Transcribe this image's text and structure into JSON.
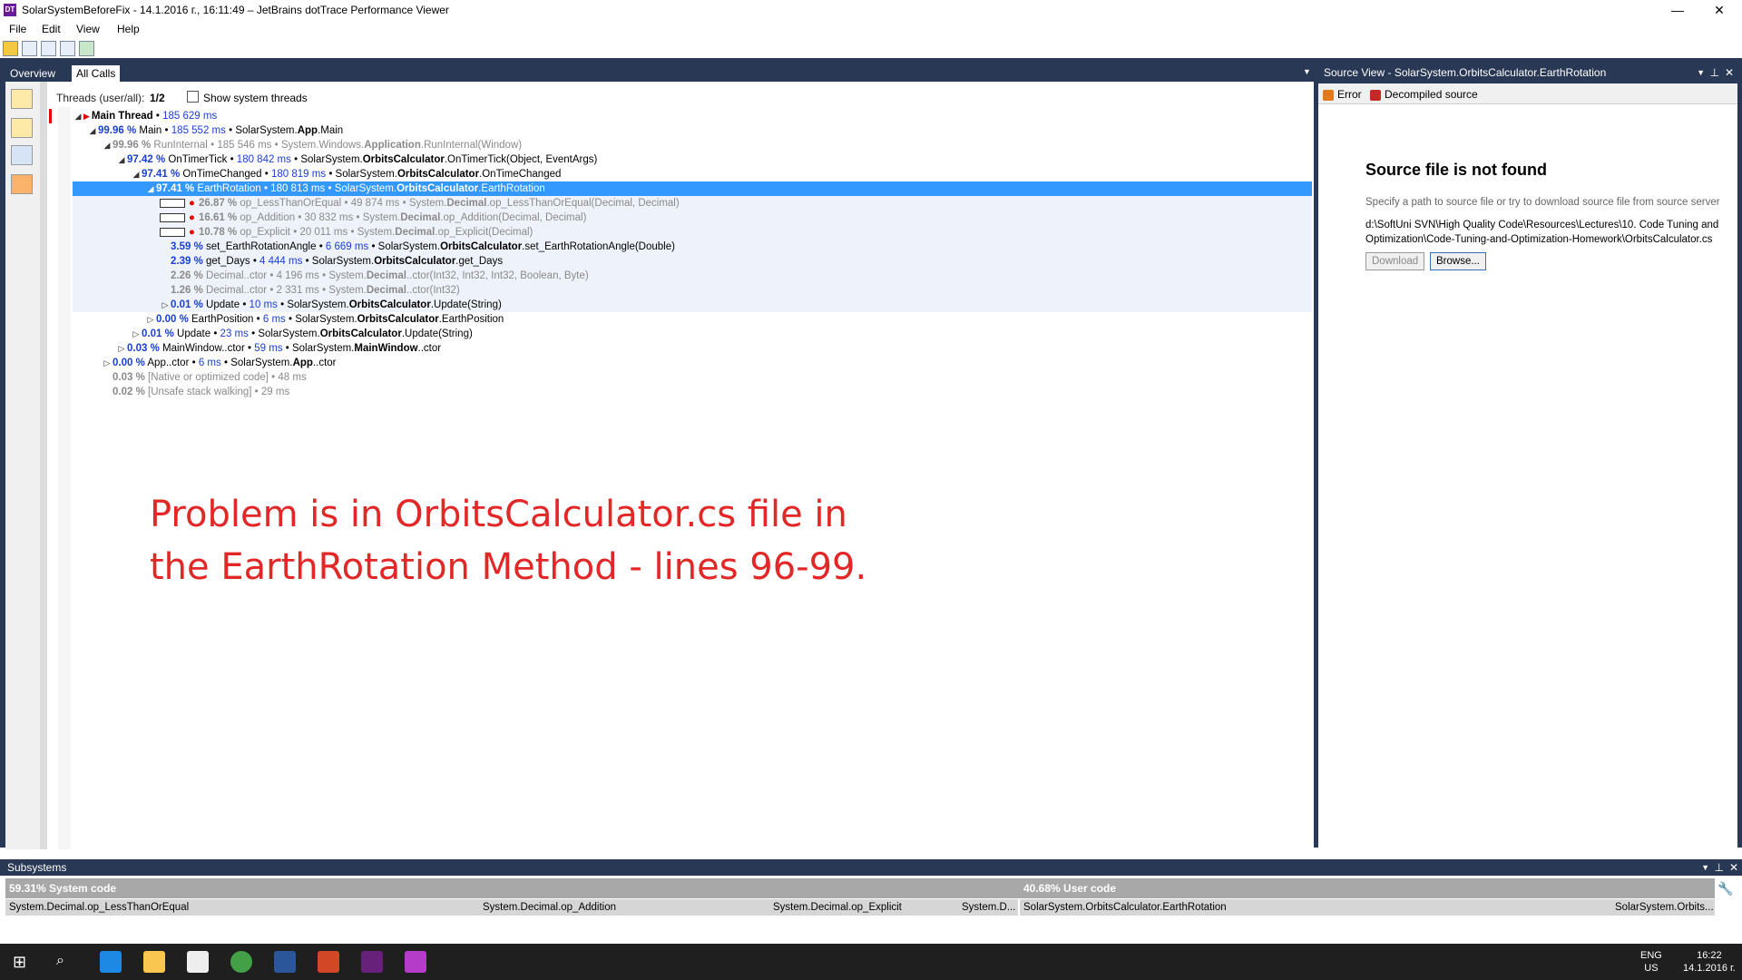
{
  "window": {
    "title": "SolarSystemBeforeFix - 14.1.2016 г., 16:11:49 – JetBrains dotTrace Performance Viewer",
    "app_icon": "DT",
    "minimize": "—",
    "restore": "❐",
    "close": "✕"
  },
  "menu": [
    "File",
    "Edit",
    "View",
    "Help"
  ],
  "tabs": [
    "Overview",
    "All Calls"
  ],
  "threads": {
    "label": "Threads (user/all):",
    "value": "1/2",
    "show_system_label": "Show system threads"
  },
  "tree": [
    {
      "arrow": "◢",
      "flag": true,
      "pct": "",
      "name": "Main Thread",
      "ms": "185 629 ms",
      "sig": "",
      "kind": "normal",
      "bold": true
    },
    {
      "arrow": "◢",
      "pct": "99.96 %",
      "name": "Main",
      "ms": "185 552 ms",
      "sig_pre": "SolarSystem.",
      "sig_bold": "App",
      "sig_post": ".Main",
      "kind": "normal"
    },
    {
      "arrow": "◢",
      "pct": "99.96 %",
      "name": "RunInternal",
      "ms": "185 546 ms",
      "sig_pre": "System.Windows.",
      "sig_bold": "Application",
      "sig_post": ".RunInternal(Window)",
      "kind": "gray"
    },
    {
      "arrow": "◢",
      "pct": "97.42 %",
      "name": "OnTimerTick",
      "ms": "180 842 ms",
      "sig_pre": "SolarSystem.",
      "sig_bold": "OrbitsCalculator",
      "sig_post": ".OnTimerTick(Object, EventArgs)",
      "kind": "normal"
    },
    {
      "arrow": "◢",
      "pct": "97.41 %",
      "name": "OnTimeChanged",
      "ms": "180 819 ms",
      "sig_pre": "SolarSystem.",
      "sig_bold": "OrbitsCalculator",
      "sig_post": ".OnTimeChanged",
      "kind": "normal"
    },
    {
      "arrow": "◢",
      "pct": "97.41 %",
      "name": "EarthRotation",
      "ms": "180 813 ms",
      "sig_pre": "SolarSystem.",
      "sig_bold": "OrbitsCalculator",
      "sig_post": ".EarthRotation",
      "kind": "selected"
    },
    {
      "arrow": "",
      "pct": "26.87 %",
      "name": "op_LessThanOrEqual",
      "ms": "49 874 ms",
      "sig_pre": "System.",
      "sig_bold": "Decimal",
      "sig_post": ".op_LessThanOrEqual(Decimal, Decimal)",
      "kind": "gray",
      "bar": true
    },
    {
      "arrow": "",
      "pct": "16.61 %",
      "name": "op_Addition",
      "ms": "30 832 ms",
      "sig_pre": "System.",
      "sig_bold": "Decimal",
      "sig_post": ".op_Addition(Decimal, Decimal)",
      "kind": "gray",
      "bar": true
    },
    {
      "arrow": "",
      "pct": "10.78 %",
      "name": "op_Explicit",
      "ms": "20 011 ms",
      "sig_pre": "System.",
      "sig_bold": "Decimal",
      "sig_post": ".op_Explicit(Decimal)",
      "kind": "gray",
      "bar": true
    },
    {
      "arrow": "",
      "pct": "3.59 %",
      "name": "set_EarthRotationAngle",
      "ms": "6 669 ms",
      "sig_pre": "SolarSystem.",
      "sig_bold": "OrbitsCalculator",
      "sig_post": ".set_EarthRotationAngle(Double)",
      "kind": "normal"
    },
    {
      "arrow": "",
      "pct": "2.39 %",
      "name": "get_Days",
      "ms": "4 444 ms",
      "sig_pre": "SolarSystem.",
      "sig_bold": "OrbitsCalculator",
      "sig_post": ".get_Days",
      "kind": "normal"
    },
    {
      "arrow": "",
      "pct": "2.26 %",
      "name": "Decimal..ctor",
      "ms": "4 196 ms",
      "sig_pre": "System.",
      "sig_bold": "Decimal",
      "sig_post": "..ctor(Int32, Int32, Int32, Boolean, Byte)",
      "kind": "gray"
    },
    {
      "arrow": "",
      "pct": "1.26 %",
      "name": "Decimal..ctor",
      "ms": "2 331 ms",
      "sig_pre": "System.",
      "sig_bold": "Decimal",
      "sig_post": "..ctor(Int32)",
      "kind": "gray"
    },
    {
      "arrow": "▷",
      "pct": "0.01 %",
      "name": "Update",
      "ms": "10 ms",
      "sig_pre": "SolarSystem.",
      "sig_bold": "OrbitsCalculator",
      "sig_post": ".Update(String)",
      "kind": "normal"
    },
    {
      "arrow": "▷",
      "pct": "0.00 %",
      "name": "EarthPosition",
      "ms": "6 ms",
      "sig_pre": "SolarSystem.",
      "sig_bold": "OrbitsCalculator",
      "sig_post": ".EarthPosition",
      "kind": "normal"
    },
    {
      "arrow": "▷",
      "pct": "0.01 %",
      "name": "Update",
      "ms": "23 ms",
      "sig_pre": "SolarSystem.",
      "sig_bold": "OrbitsCalculator",
      "sig_post": ".Update(String)",
      "kind": "normal"
    },
    {
      "arrow": "▷",
      "pct": "0.03 %",
      "name": "MainWindow..ctor",
      "ms": "59 ms",
      "sig_pre": "SolarSystem.",
      "sig_bold": "MainWindow",
      "sig_post": "..ctor",
      "kind": "normal"
    },
    {
      "arrow": "▷",
      "pct": "0.00 %",
      "name": "App..ctor",
      "ms": "6 ms",
      "sig_pre": "SolarSystem.",
      "sig_bold": "App",
      "sig_post": "..ctor",
      "kind": "normal"
    },
    {
      "arrow": "",
      "pct": "0.03 %",
      "name": "[Native or optimized code]",
      "ms": "48 ms",
      "sig_pre": "",
      "sig_bold": "",
      "sig_post": "",
      "kind": "gray"
    },
    {
      "arrow": "",
      "pct": "0.02 %",
      "name": "[Unsafe stack walking]",
      "ms": "29 ms",
      "sig_pre": "",
      "sig_bold": "",
      "sig_post": "",
      "kind": "gray"
    }
  ],
  "annotation": {
    "line1": "Problem is in OrbitsCalculator.cs file in",
    "line2": "the EarthRotation Method - lines 96-99."
  },
  "source_view": {
    "title": "Source View - SolarSystem.OrbitsCalculator.EarthRotation",
    "tab_error": "Error",
    "tab_decompiled": "Decompiled source",
    "heading": "Source file is not found",
    "description": "Specify a path to source file or try to download source file from source server",
    "path_line1": "d:\\SoftUni SVN\\High Quality Code\\Resources\\Lectures\\10. Code Tuning and",
    "path_line2": "Optimization\\Code-Tuning-and-Optimization-Homework\\OrbitsCalculator.cs",
    "download_label": "Download",
    "browse_label": "Browse..."
  },
  "subsystems": {
    "title": "Subsystems",
    "system_code": "59.31% System code",
    "user_code": "40.68% User code",
    "cells": [
      "System.Decimal.op_LessThanOrEqual",
      "System.Decimal.op_Addition",
      "System.Decimal.op_Explicit",
      "System.D...",
      "SolarSystem.OrbitsCalculator.EarthRotation",
      "SolarSystem.Orbits..."
    ]
  },
  "taskbar": {
    "lang1": "ENG",
    "lang2": "US",
    "time": "16:22",
    "date": "14.1.2016 г."
  },
  "colors": {
    "accent_dark": "#293955",
    "selection": "#3399ff",
    "annotation_red": "#e32626",
    "pct_blue": "#1a3fd0"
  }
}
